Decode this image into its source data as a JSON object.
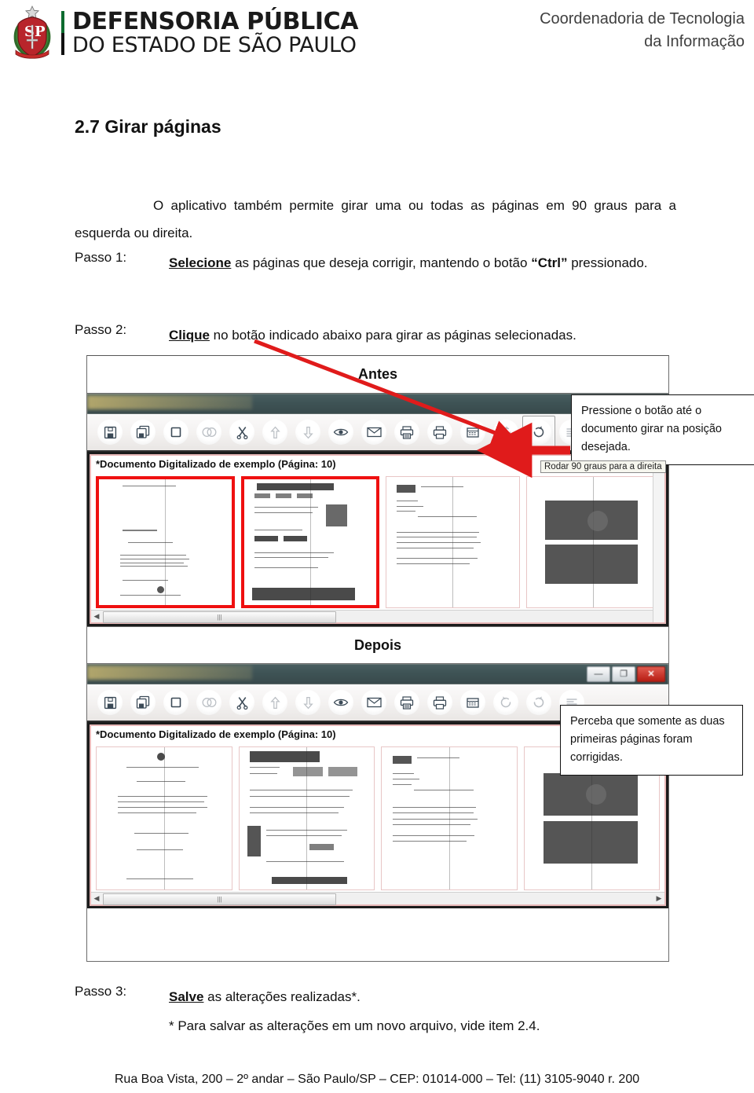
{
  "header": {
    "brand_line1": "DEFENSORIA PÚBLICA",
    "brand_line2": "DO ESTADO DE SÃO PAULO",
    "department_line1": "Coordenadoria de Tecnologia",
    "department_line2": "da Informação",
    "accent_green": "#0d6b2f",
    "shield_red": "#b8252b"
  },
  "document": {
    "section_title": "2.7 Girar páginas",
    "intro": "O aplicativo também permite girar uma ou todas as páginas em 90 graus para a esquerda ou direita.",
    "steps": [
      {
        "label": "Passo 1:",
        "text_bold_underline": "Selecione",
        "text_rest": " as páginas que deseja corrigir, mantendo o botão ",
        "text_quoted_bold": "“Ctrl”",
        "text_tail": " pressionado."
      },
      {
        "label": "Passo 2:",
        "text_bold_underline": "Clique",
        "text_rest": " no botão indicado abaixo para girar as páginas selecionadas."
      },
      {
        "label": "Passo 3:",
        "text_bold_underline": "Salve",
        "text_rest": " as alterações realizadas*."
      }
    ],
    "footnote": "* Para salvar as alterações em um novo arquivo, vide item 2.4."
  },
  "figure": {
    "caption_before": "Antes",
    "caption_after": "Depois",
    "callout_before": "Pressione o botão até o documento girar na posição desejada.",
    "callout_after": "Perceba que somente as duas primeiras páginas foram corrigidas.",
    "annotation_color": "#e01b1b"
  },
  "app_window": {
    "document_title": "*Documento Digitalizado de exemplo (Página: 10)",
    "tooltip": "Rodar 90 graus para a direita",
    "window_buttons": [
      {
        "name": "minimize",
        "glyph": "—"
      },
      {
        "name": "maximize",
        "glyph": "❐"
      },
      {
        "name": "close",
        "glyph": "✕"
      }
    ],
    "toolbar_icons": [
      "save-icon",
      "save-as-icon",
      "new-page-icon",
      "merge-icon",
      "cut-icon",
      "move-up-icon",
      "move-down-icon",
      "preview-icon",
      "email-icon",
      "print-preview-icon",
      "print-icon",
      "ocr-icon",
      "rotate-left-icon",
      "rotate-right-icon",
      "properties-icon"
    ],
    "rotate_button_index": 13,
    "scroll_hint": "|||"
  },
  "footer": {
    "text": "Rua Boa Vista, 200 – 2º andar – São Paulo/SP – CEP: 01014-000 – Tel: (11) 3105-9040 r. 200"
  }
}
